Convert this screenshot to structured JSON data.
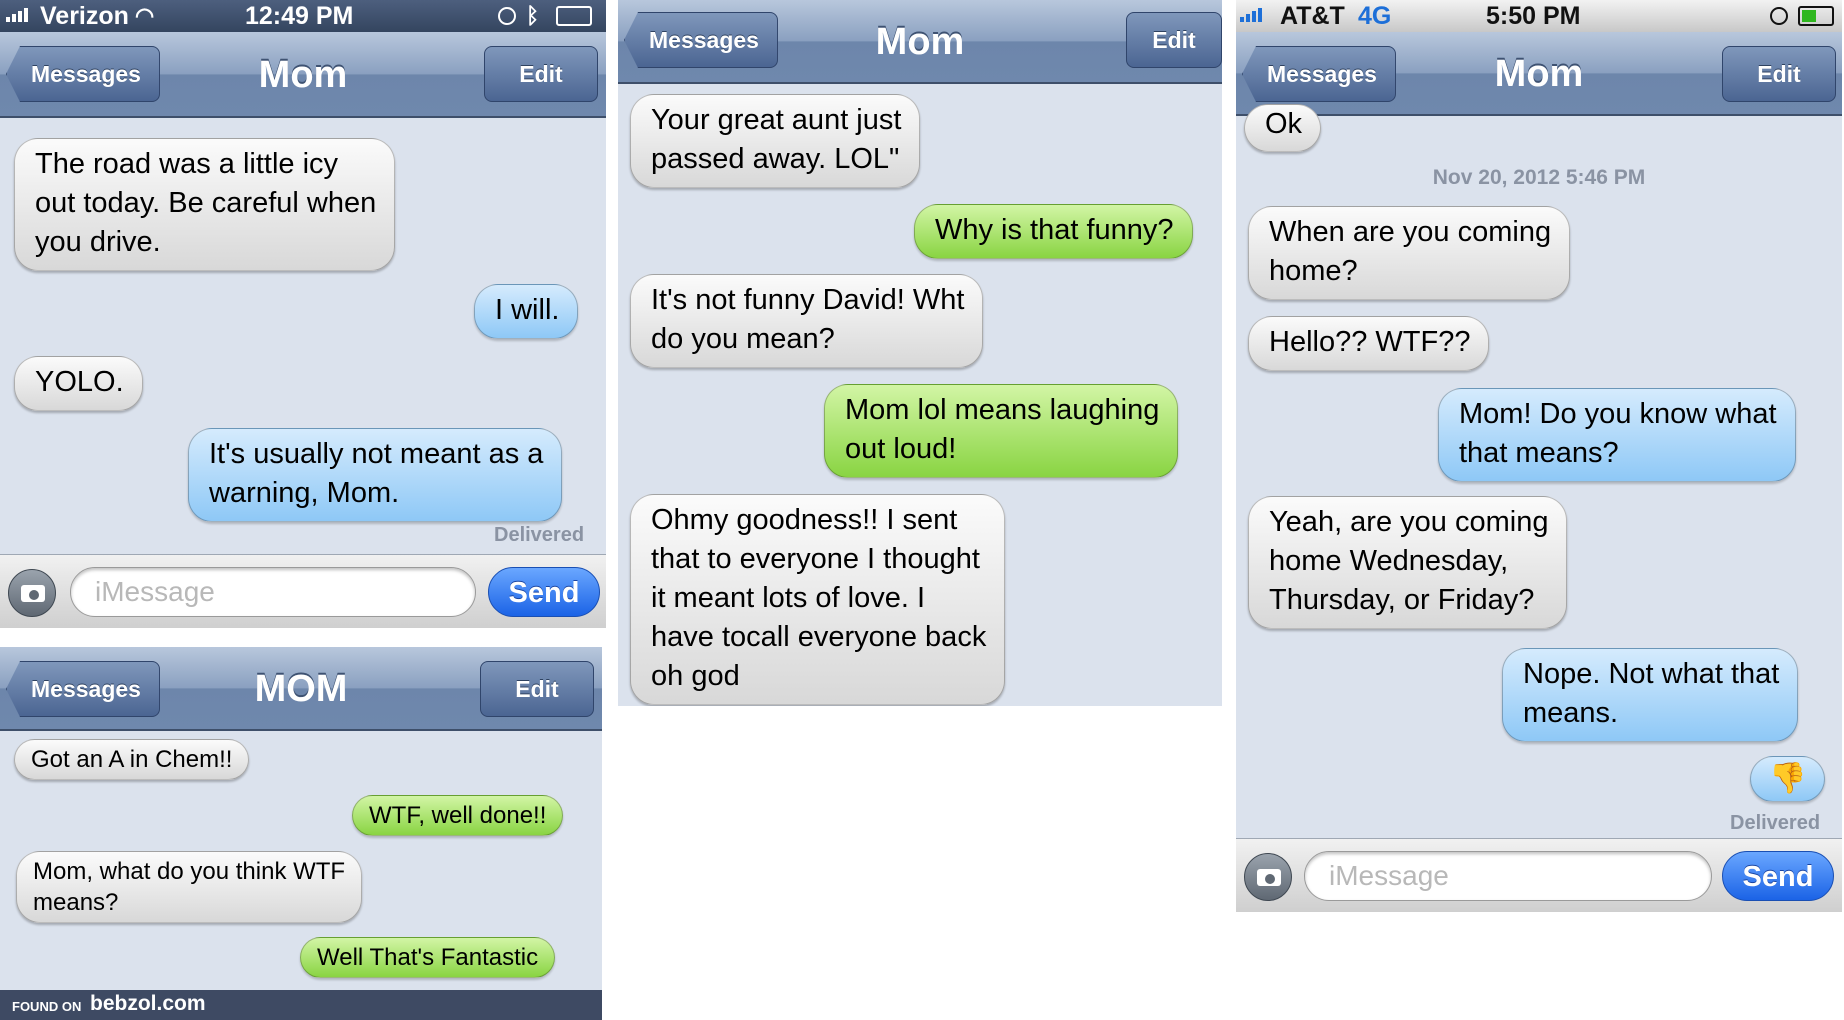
{
  "panel1": {
    "status": {
      "carrier": "Verizon",
      "time": "12:49 PM"
    },
    "nav": {
      "back": "Messages",
      "title": "Mom",
      "edit": "Edit"
    },
    "messages": [
      {
        "from": "them",
        "text": "The road was a little icy\nout today. Be careful when\nyou drive."
      },
      {
        "from": "me",
        "text": "I will."
      },
      {
        "from": "them",
        "text": "YOLO."
      },
      {
        "from": "me",
        "text": "It's usually not meant as a\nwarning, Mom."
      }
    ],
    "delivered": "Delivered",
    "composer": {
      "placeholder": "iMessage",
      "send": "Send"
    }
  },
  "panel2": {
    "nav": {
      "back": "Messages",
      "title": "MOM",
      "edit": "Edit"
    },
    "messages": [
      {
        "from": "them",
        "text": "Got an A in Chem!!"
      },
      {
        "from": "me",
        "text": "WTF, well done!!"
      },
      {
        "from": "them",
        "text": "Mom, what do you think WTF\nmeans?"
      },
      {
        "from": "me",
        "text": "Well That's Fantastic"
      }
    ],
    "footer": {
      "found": "FOUND ON",
      "site": "bebzol.com"
    }
  },
  "panel3": {
    "nav": {
      "back": "Messages",
      "title": "Mom",
      "edit": "Edit"
    },
    "messages": [
      {
        "from": "them",
        "text": "Your great aunt just\npassed away. LOL\""
      },
      {
        "from": "me",
        "text": "Why is that funny?"
      },
      {
        "from": "them",
        "text": "It's not funny David! Wht\ndo you mean?"
      },
      {
        "from": "me",
        "text": "Mom lol means laughing\nout loud!"
      },
      {
        "from": "them",
        "text": "Ohmy goodness!! I sent\nthat to everyone I thought\nit meant lots of love. I\nhave tocall everyone back\noh god"
      }
    ]
  },
  "panel4": {
    "status": {
      "carrier": "AT&T",
      "network": "4G",
      "time": "5:50 PM"
    },
    "nav": {
      "back": "Messages",
      "title": "Mom",
      "edit": "Edit"
    },
    "messages": [
      {
        "from": "them",
        "text": "Ok"
      },
      {
        "from": "them",
        "text": "When are you coming\nhome?"
      },
      {
        "from": "them",
        "text": "Hello?? WTF??"
      },
      {
        "from": "me",
        "text": "Mom! Do you know what\nthat means?"
      },
      {
        "from": "them",
        "text": "Yeah, are you coming\nhome Wednesday,\nThursday, or Friday?"
      },
      {
        "from": "me",
        "text": "Nope. Not what that\nmeans."
      },
      {
        "from": "me",
        "text": "👎"
      }
    ],
    "timestamp": "Nov 20, 2012 5:46 PM",
    "delivered": "Delivered",
    "composer": {
      "placeholder": "iMessage",
      "send": "Send"
    }
  },
  "colors": {
    "incoming": "#e3e3e3",
    "outgoing_imessage": "#a8d5f9",
    "outgoing_sms": "#9fe05b",
    "nav": "#7e95b8",
    "send": "#2f78f0"
  }
}
